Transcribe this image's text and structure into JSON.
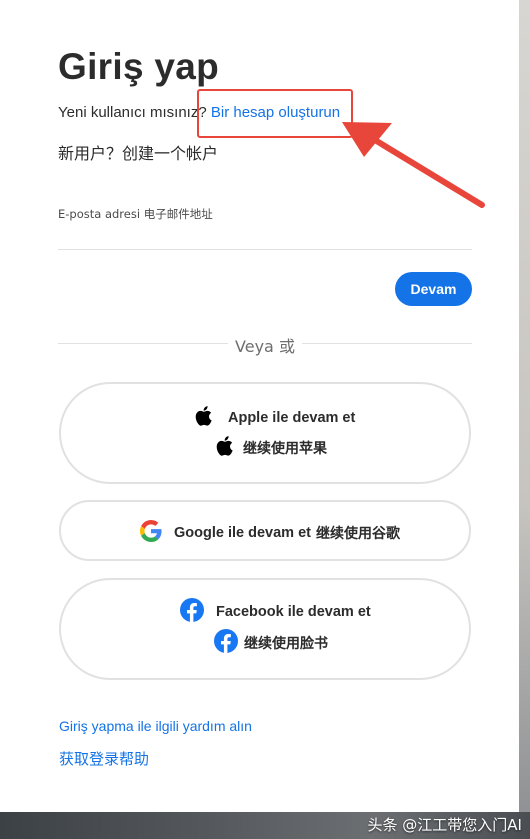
{
  "page": {
    "title": "Giriş yap",
    "new_user_question": "Yeni kullanıcı mısınız?",
    "create_account_link": "Bir hesap oluşturun",
    "new_user_cn": "新用户？创建一个帐户",
    "email_label": "E-posta adresi 电子邮件地址",
    "email_value": "",
    "continue_button": "Devam",
    "divider_text": "Veya 或",
    "apple": {
      "label": "Apple ile devam et",
      "label_cn": "继续使用苹果"
    },
    "google": {
      "label": "Google ile devam et",
      "label_cn": "继续使用谷歌"
    },
    "facebook": {
      "label": "Facebook ile devam et",
      "label_cn": "继续使用脸书"
    },
    "help_link": "Giriş yapma ile ilgili yardım alın",
    "help_link_cn": "获取登录帮助",
    "watermark": "头条 @江工带您入门AI"
  },
  "colors": {
    "accent": "#1473e6",
    "annotation": "#e8463a",
    "text": "#2c2c2c",
    "border": "#e1e1e1"
  },
  "icons": [
    "apple-icon",
    "google-icon",
    "facebook-icon",
    "annotation-arrow"
  ]
}
